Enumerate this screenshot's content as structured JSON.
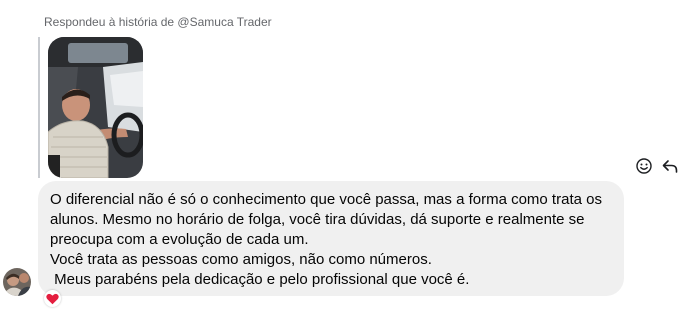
{
  "reply": {
    "header": "Respondeu à história de @Samuca Trader"
  },
  "story": {
    "icon": "story-photo-thumbnail"
  },
  "actions": {
    "react_icon": "smiley-icon",
    "reply_icon": "reply-arrow-icon"
  },
  "message": {
    "lines": [
      "O diferencial não é só o conhecimento que você passa, mas a forma como trata os",
      "alunos. Mesmo no horário de folga, você tira dúvidas, dá suporte e realmente se",
      "preocupa com a evolução de cada um.",
      "Você trata as pessoas como amigos, não como números.",
      " Meus parabéns pela dedicação e pelo profissional que você é."
    ]
  },
  "reaction": {
    "icon": "heart-icon",
    "color": "#e41e3f"
  },
  "colors": {
    "bubble": "#f0f0f0",
    "meta_text": "#65676b"
  }
}
